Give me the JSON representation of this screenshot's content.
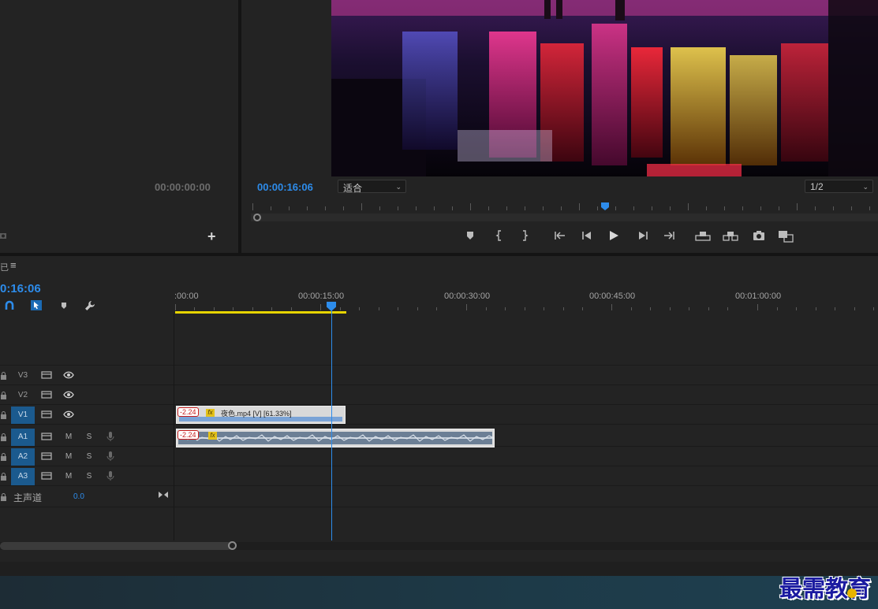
{
  "source_monitor": {
    "timecode": "00:00:00:00",
    "camera_icon": "camera-icon",
    "add_label": "+"
  },
  "program_monitor": {
    "timecode": "00:00:16:06",
    "fit_value": "适合",
    "resolution_value": "1/2",
    "controls": [
      "marker-icon",
      "mark-in-icon",
      "mark-out-icon",
      "go-to-in-icon",
      "step-back-icon",
      "play-icon",
      "step-forward-icon",
      "go-to-out-icon",
      "lift-icon",
      "extract-icon",
      "export-frame-icon",
      "insert-overlay-icon"
    ]
  },
  "timeline": {
    "menu_glyph_left": "已",
    "menu_icon": "≡",
    "current_time": "0:16:06",
    "ruler_labels": [
      ":00:00",
      "00:00:15:00",
      "00:00:30:00",
      "00:00:45:00",
      "00:01:00:00"
    ],
    "video_tracks": [
      {
        "label": "V3",
        "active": false
      },
      {
        "label": "V2",
        "active": false
      },
      {
        "label": "V1",
        "active": true
      }
    ],
    "audio_tracks": [
      {
        "label": "A1",
        "m": "M",
        "s": "S"
      },
      {
        "label": "A2",
        "m": "M",
        "s": "S"
      },
      {
        "label": "A3",
        "m": "M",
        "s": "S"
      }
    ],
    "master": {
      "label": "主声道",
      "value": "0.0"
    },
    "video_clip": {
      "speed_badge": "-2.24",
      "fx": "fx",
      "name": "夜色.mp4 [V] [61.33%]"
    },
    "audio_clip": {
      "speed_badge": "-2.24",
      "fx": "fx"
    }
  },
  "watermark": "最需教育",
  "colors": {
    "accent": "#2d8ceb",
    "work_area": "#e7d400",
    "track_active": "#1b5a8e",
    "video_clip": "#7aa3d6"
  }
}
